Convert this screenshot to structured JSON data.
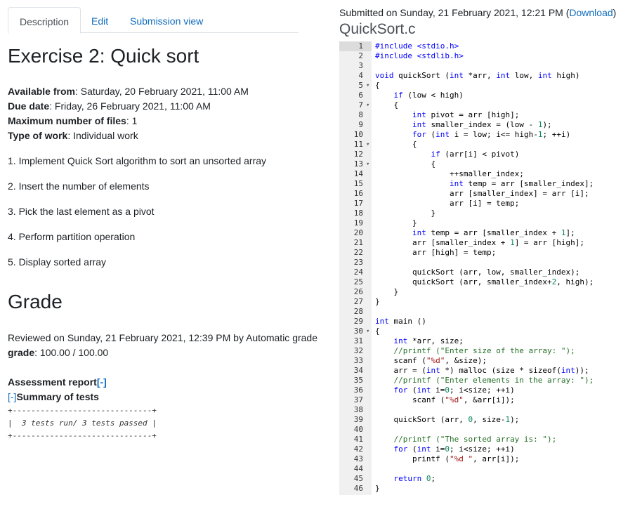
{
  "tabs": [
    {
      "label": "Description",
      "active": true
    },
    {
      "label": "Edit",
      "active": false
    },
    {
      "label": "Submission view",
      "active": false
    }
  ],
  "exercise_title": "Exercise 2: Quick sort",
  "meta": [
    {
      "label": "Available from",
      "value": "Saturday, 20 February 2021, 11:00 AM"
    },
    {
      "label": "Due date",
      "value": "Friday, 26 February 2021, 11:00 AM"
    },
    {
      "label": "Maximum number of files",
      "value": "1"
    },
    {
      "label": "Type of work",
      "value": "Individual work"
    }
  ],
  "steps": [
    "1. Implement Quick Sort algorithm to sort an unsorted array",
    "2. Insert the number of elements",
    "3. Pick the last element as a pivot",
    "4. Perform partition operation",
    "5. Display sorted array"
  ],
  "grade_heading": "Grade",
  "reviewed_text": "Reviewed on Sunday, 21 February 2021, 12:39 PM by Automatic grade",
  "grade_label": "grade",
  "grade_value": "100.00 / 100.00",
  "assessment_label": "Assessment report",
  "assessment_toggle": "[-]",
  "summary_toggle": "[-]",
  "summary_label": "Summary of tests",
  "test_output": {
    "border_line": "+------------------------------+",
    "result_line": "|  3 tests run/ 3 tests passed |"
  },
  "submission": {
    "submitted_text": "Submitted on Sunday, 21 February 2021, 12:21 PM (",
    "download_label": "Download",
    "close_paren": ")",
    "filename": "QuickSort.c"
  },
  "code_lines": [
    "#include <stdio.h>",
    "#include <stdlib.h>",
    "",
    "void quickSort (int *arr, int low, int high)",
    "{",
    "    if (low < high)",
    "    {",
    "        int pivot = arr [high];",
    "        int smaller_index = (low - 1);",
    "        for (int i = low; i<= high-1; ++i)",
    "        {",
    "            if (arr[i] < pivot)",
    "            {",
    "                ++smaller_index;",
    "                int temp = arr [smaller_index];",
    "                arr [smaller_index] = arr [i];",
    "                arr [i] = temp;",
    "            }",
    "        }",
    "        int temp = arr [smaller_index + 1];",
    "        arr [smaller_index + 1] = arr [high];",
    "        arr [high] = temp;",
    "",
    "        quickSort (arr, low, smaller_index);",
    "        quickSort (arr, smaller_index+2, high);",
    "    }",
    "}",
    "",
    "int main ()",
    "{",
    "    int *arr, size;",
    "    //printf (\"Enter size of the array: \");",
    "    scanf (\"%d\", &size);",
    "    arr = (int *) malloc (size * sizeof(int));",
    "    //printf (\"Enter elements in the array: \");",
    "    for (int i=0; i<size; ++i)",
    "        scanf (\"%d\", &arr[i]);",
    "",
    "    quickSort (arr, 0, size-1);",
    "",
    "    //printf (\"The sorted array is: \");",
    "    for (int i=0; i<size; ++i)",
    "        printf (\"%d \", arr[i]);",
    "",
    "    return 0;",
    "}"
  ],
  "fold_markers": {
    "5": "▾",
    "7": "▾",
    "11": "▾",
    "13": "▾",
    "30": "▾"
  },
  "colors": {
    "link": "#0f6cbf",
    "keyword": "#0000ff",
    "string": "#a31515",
    "comment": "#236e25",
    "number": "#09885a",
    "gutter": "#f0f0f0"
  }
}
